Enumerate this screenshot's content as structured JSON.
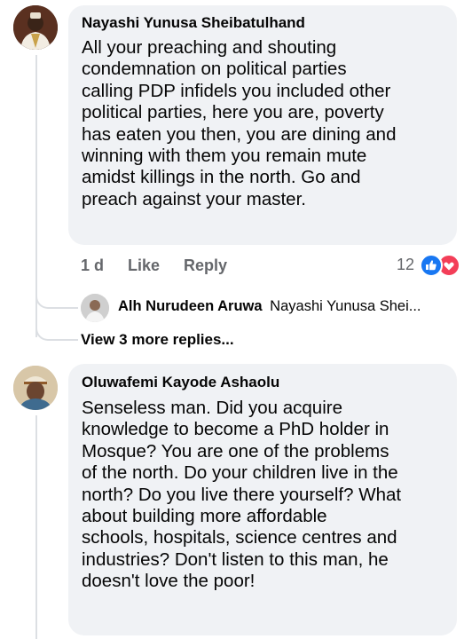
{
  "comments": [
    {
      "author": "Nayashi Yunusa Sheibatulhand",
      "lines": [
        "All your preaching and shouting",
        "condemnation on political parties",
        "calling PDP infidels you included other",
        "political parties, here you are, poverty",
        "has eaten you then, you are dining and",
        "winning with them you remain mute",
        "amidst killings in the north. Go and",
        "preach against your master."
      ],
      "time": "1 d",
      "like_label": "Like",
      "reply_label": "Reply",
      "reaction_count": "12",
      "reply_preview": {
        "author": "Alh Nurudeen Aruwa",
        "text": "Nayashi Yunusa Shei..."
      },
      "more_replies": "View 3 more replies..."
    },
    {
      "author": "Oluwafemi Kayode Ashaolu",
      "lines": [
        "Senseless man. Did you acquire",
        "knowledge to become a PhD holder in",
        "Mosque? You are one of the problems",
        "of the north. Do your children live in the",
        "north? Do you live there yourself? What",
        "about building more affordable",
        "schools, hospitals, science centres and",
        "industries? Don't listen to this man, he",
        "doesn't love the poor!"
      ]
    }
  ],
  "colors": {
    "bubble": "#f0f2f5",
    "meta": "#65676b",
    "like_blue": "#1877f2",
    "love_red": "#f33e58"
  },
  "icons": [
    "like-reaction-icon",
    "love-reaction-icon"
  ]
}
